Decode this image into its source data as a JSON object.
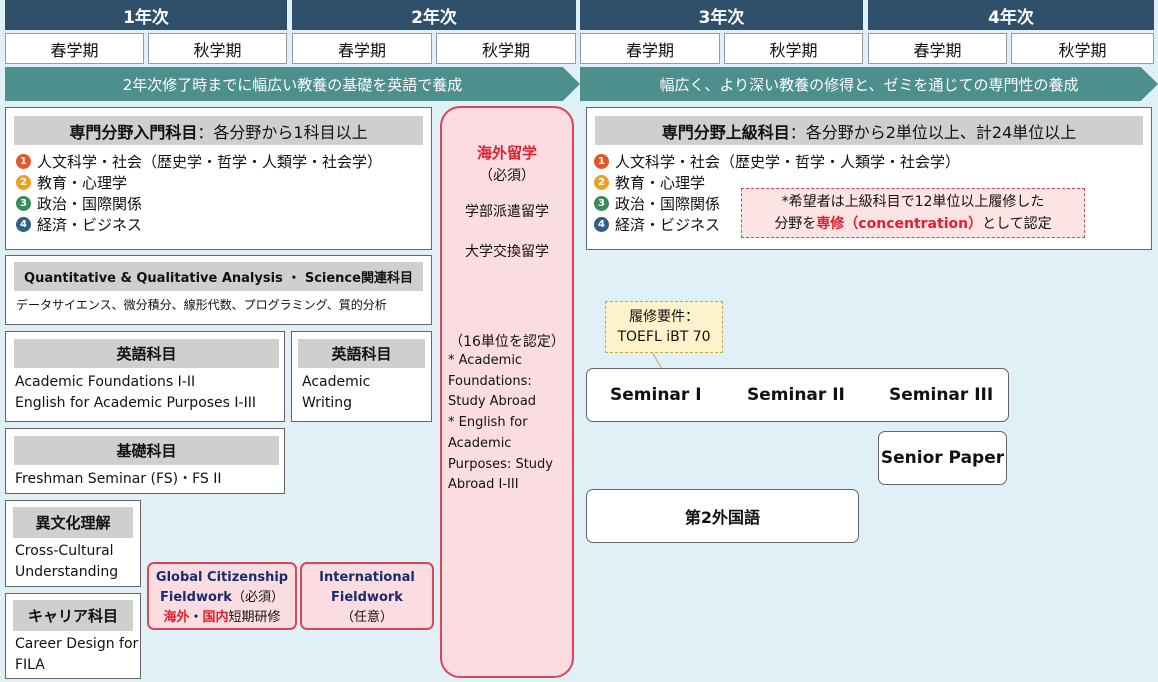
{
  "years": [
    "1年次",
    "2年次",
    "3年次",
    "4年次"
  ],
  "semesters": [
    "春学期",
    "秋学期",
    "春学期",
    "秋学期",
    "春学期",
    "秋学期",
    "春学期",
    "秋学期"
  ],
  "bands": {
    "left": "2年次修了時までに幅広い教養の基礎を英語で養成",
    "right": "幅広く、より深い教養の修得と、ゼミを通じての専門性の養成"
  },
  "intro": {
    "title": "専門分野入門科目",
    "title_suffix": "：各分野から1科目以上",
    "fields": [
      {
        "num": "1",
        "label": "人文科学・社会（歴史学・哲学・人類学・社会学）",
        "color": "#e2572b"
      },
      {
        "num": "2",
        "label": "教育・心理学",
        "color": "#f0a020"
      },
      {
        "num": "3",
        "label": "政治・国際関係",
        "color": "#3a8a5a"
      },
      {
        "num": "4",
        "label": "経済・ビジネス",
        "color": "#2f5f8a"
      }
    ]
  },
  "qqa": {
    "title": "Quantitative & Qualitative Analysis ・ Science関連科目",
    "desc": "データサイエンス、微分積分、線形代数、プログラミング、質的分析"
  },
  "english1": {
    "title": "英語科目",
    "line1": "Academic Foundations I-II",
    "line2": "English for Academic Purposes I-III"
  },
  "english2": {
    "title": "英語科目",
    "line1": "Academic",
    "line2": "Writing"
  },
  "basic": {
    "title": "基礎科目",
    "line1": "Freshman Seminar (FS)・FS II"
  },
  "cross": {
    "title": "異文化理解",
    "line1": "Cross-Cultural",
    "line2": "Understanding"
  },
  "career": {
    "title": "キャリア科目",
    "line1": "Career Design for",
    "line2": "FILA"
  },
  "gcf": {
    "line1": "Global Citizenship",
    "line2a": "Fieldwork",
    "line2b": "（必須）",
    "line3a": "海外",
    "line3b": "・",
    "line3c": "国内",
    "line3d": "短期研修"
  },
  "ifw": {
    "line1": "International",
    "line2": "Fieldwork",
    "line3": "（任意）"
  },
  "abroad": {
    "title": "海外留学",
    "required": "（必須）",
    "type1": "学部派遣留学",
    "type2": "大学交換留学",
    "credits": "（16単位を認定）",
    "notes": [
      "* Academic",
      "Foundations:",
      "Study Abroad",
      "* English for",
      "Academic",
      "Purposes: Study",
      "Abroad I-III"
    ]
  },
  "advanced": {
    "title": "専門分野上級科目",
    "title_suffix": "：各分野から2単位以上、計24単位以上",
    "fields": [
      {
        "num": "1",
        "label": "人文科学・社会（歴史学・哲学・人類学・社会学）",
        "color": "#e2572b"
      },
      {
        "num": "2",
        "label": "教育・心理学",
        "color": "#f0a020"
      },
      {
        "num": "3",
        "label": "政治・国際関係",
        "color": "#3a8a5a"
      },
      {
        "num": "4",
        "label": "経済・ビジネス",
        "color": "#2f5f8a"
      }
    ],
    "note1": "*希望者は上級科目で12単位以上履修した",
    "note2a": "分野を",
    "note2b": "専修（concentration）",
    "note2c": "として認定"
  },
  "toefl": {
    "line1": "履修要件：",
    "line2": "TOEFL iBT 70"
  },
  "seminars": [
    "Seminar I",
    "Seminar II",
    "Seminar III"
  ],
  "senior_paper": "Senior Paper",
  "second_language": "第2外国語",
  "colors": {
    "year_bg": "#2f4f6b",
    "band_bg": "#4d8f8c",
    "page_bg": "#dff1f6",
    "accent_red": "#e02030",
    "pink_bg": "#fbdde1"
  }
}
